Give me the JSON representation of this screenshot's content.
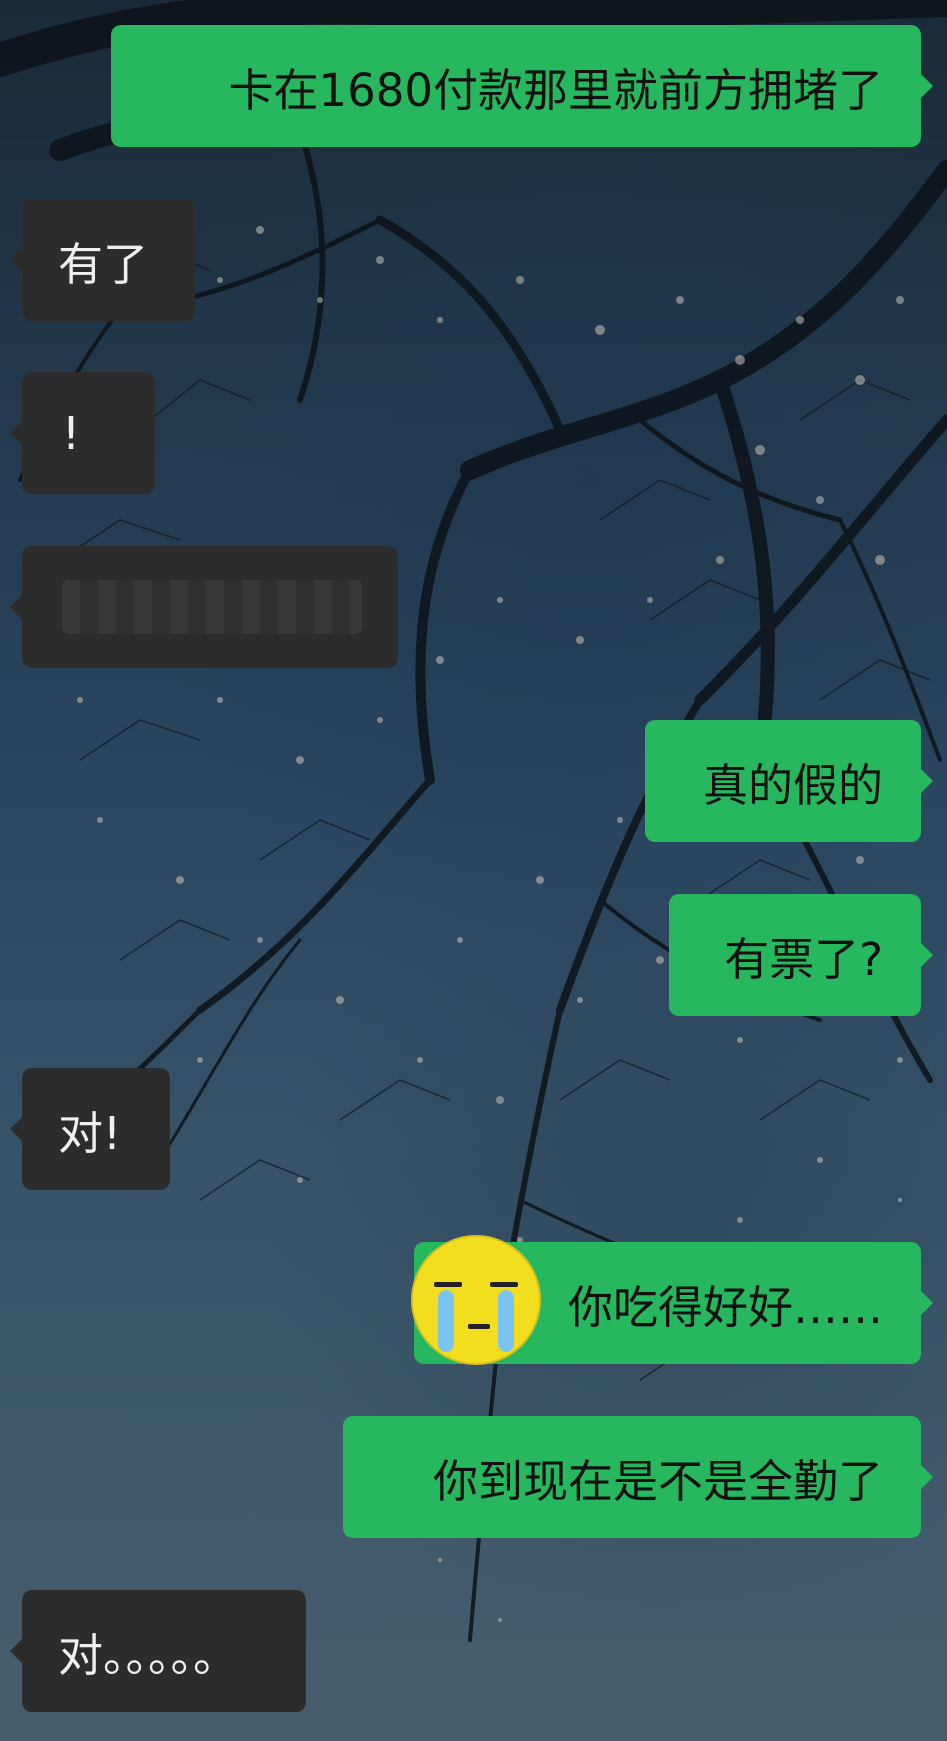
{
  "conversation": {
    "messages": [
      {
        "side": "out",
        "text": "卡在1680付款那里就前方拥堵了"
      },
      {
        "side": "in",
        "text": "有了"
      },
      {
        "side": "in",
        "text": "!"
      },
      {
        "side": "in",
        "text": "",
        "redacted": true
      },
      {
        "side": "out",
        "text": "真的假的"
      },
      {
        "side": "out",
        "text": "有票了?"
      },
      {
        "side": "in",
        "text": "对!"
      },
      {
        "side": "out",
        "text": "你吃得好好……",
        "sticker": "crying-face-sticker"
      },
      {
        "side": "out",
        "text": "你到现在是不是全勤了"
      },
      {
        "side": "in",
        "text": "对。。。。。"
      }
    ]
  },
  "colors": {
    "outgoing_bubble": "#27b85f",
    "incoming_bubble": "#2c2c2c",
    "sticker_face": "#f2dd1f",
    "sticker_tears": "#7cc4f0"
  },
  "background": {
    "description_icon": "blossom-tree-sky-wallpaper"
  }
}
